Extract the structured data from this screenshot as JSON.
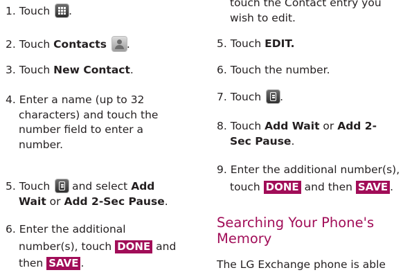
{
  "left": {
    "s1": {
      "num": "1.",
      "t1": "Touch",
      "t2": "."
    },
    "s2": {
      "num": "2.",
      "t1": "Touch",
      "b1": "Contacts",
      "t2": "."
    },
    "s3": {
      "num": "3.",
      "t1": "Touch",
      "b1": "New Contact",
      "t2": "."
    },
    "s4": {
      "num": "4.",
      "l1": "Enter a name (up to 32",
      "l2": "characters) and touch the",
      "l3": "number field to enter a",
      "l4": "number."
    },
    "s5": {
      "num": "5.",
      "t1": "Touch",
      "t2": "and select",
      "b1": "Add",
      "b2": "Wait",
      "t3": "or",
      "b3": "Add 2-Sec Pause",
      "t4": "."
    },
    "s6": {
      "num": "6.",
      "l1": "Enter the additional",
      "t1": "number(s), touch",
      "key1": "DONE",
      "t2": "and",
      "t3": "then",
      "key2": "SAVE",
      "t4": "."
    }
  },
  "right": {
    "partial1": "touch the Contact entry you",
    "partial2": "wish to edit.",
    "s5": {
      "num": "5.",
      "t1": "Touch",
      "b1": "EDIT."
    },
    "s6": {
      "num": "6.",
      "t1": "Touch the number."
    },
    "s7": {
      "num": "7.",
      "t1": "Touch",
      "t2": "."
    },
    "s8": {
      "num": "8.",
      "t1": "Touch",
      "b1": "Add Wait",
      "t2": "or",
      "b2": "Add 2-",
      "b3": "Sec Pause",
      "t3": "."
    },
    "s9": {
      "num": "9.",
      "l1": "Enter the additional number(s),",
      "t1": "touch",
      "key1": "DONE",
      "t2": "and then",
      "key2": "SAVE",
      "t3": "."
    },
    "heading": {
      "l1": "Searching Your Phone's",
      "l2": "Memory"
    },
    "body": "The LG Exchange phone is able"
  },
  "icons": {
    "apps": "apps-grid-icon",
    "contacts": "contacts-icon",
    "menu": "menu-key-icon"
  },
  "colors": {
    "accent": "#a10d58",
    "text": "#231f20"
  }
}
